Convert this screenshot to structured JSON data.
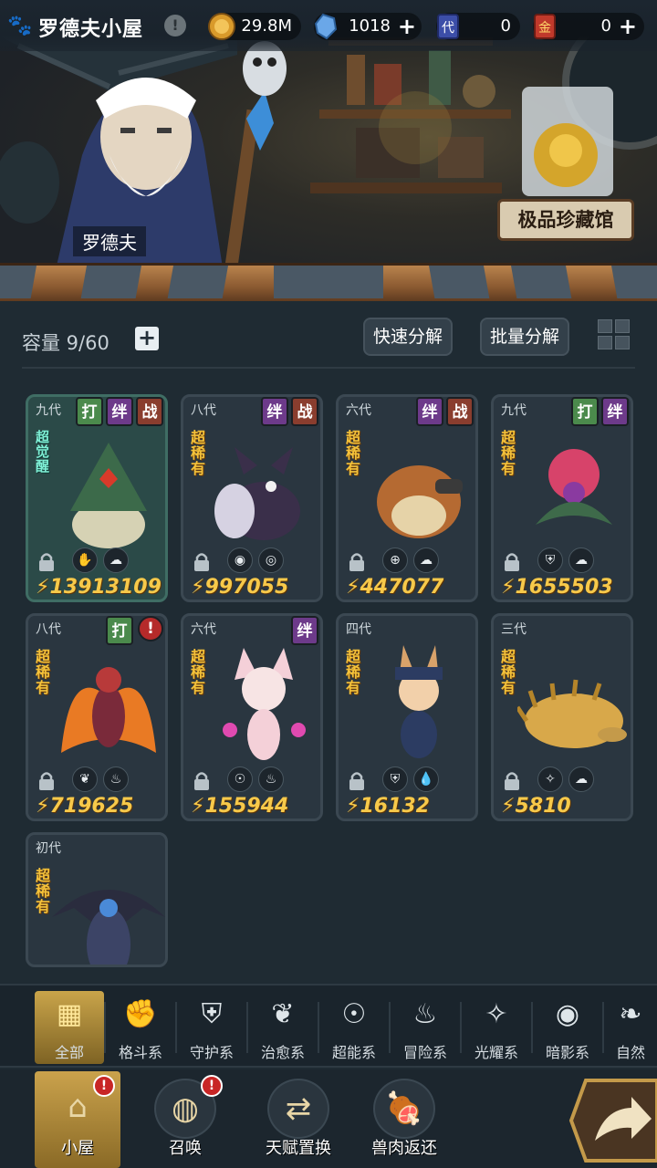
{
  "header": {
    "title": "罗德夫小屋",
    "info_glyph": "!",
    "gold": "29.8M",
    "crystal": "1018",
    "ticket_purple": "0",
    "ticket_gold": "0",
    "plus_glyph": "+",
    "ticket_purple_glyph": "代",
    "ticket_gold_glyph": "金"
  },
  "banner": {
    "npc_name": "罗德夫",
    "treasure_button": "极品珍藏馆"
  },
  "toolbar": {
    "capacity_label": "容量 9/60",
    "quick_decompose": "快速分解",
    "batch_decompose": "批量分解"
  },
  "tags": {
    "da": "打",
    "ban": "绊",
    "zhan": "战",
    "alert": "!"
  },
  "cards": [
    {
      "generation": "九代",
      "badge": "超觉醒",
      "power": "13913109",
      "tags": [
        "da",
        "ban",
        "zhan"
      ],
      "featured": true
    },
    {
      "generation": "八代",
      "badge": "超稀有",
      "power": "997055",
      "tags": [
        "ban",
        "zhan"
      ]
    },
    {
      "generation": "六代",
      "badge": "超稀有",
      "power": "447077",
      "tags": [
        "ban",
        "zhan"
      ]
    },
    {
      "generation": "九代",
      "badge": "超稀有",
      "power": "1655503",
      "tags": [
        "da",
        "ban"
      ]
    },
    {
      "generation": "八代",
      "badge": "超稀有",
      "power": "719625",
      "tags": [
        "da",
        "alert"
      ]
    },
    {
      "generation": "六代",
      "badge": "超稀有",
      "power": "155944",
      "tags": [
        "ban"
      ]
    },
    {
      "generation": "四代",
      "badge": "超稀有",
      "power": "16132",
      "tags": []
    },
    {
      "generation": "三代",
      "badge": "超稀有",
      "power": "5810",
      "tags": []
    },
    {
      "generation": "初代",
      "badge": "超稀有",
      "power": "",
      "tags": []
    }
  ],
  "filters": [
    {
      "label": "全部",
      "icon": "blocks-icon"
    },
    {
      "label": "格斗系",
      "icon": "fist-icon"
    },
    {
      "label": "守护系",
      "icon": "shield-icon"
    },
    {
      "label": "治愈系",
      "icon": "sprout-icon"
    },
    {
      "label": "超能系",
      "icon": "alien-icon"
    },
    {
      "label": "冒险系",
      "icon": "flame-emblem-icon"
    },
    {
      "label": "光耀系",
      "icon": "star-burst-icon"
    },
    {
      "label": "暗影系",
      "icon": "eye-icon"
    },
    {
      "label": "自然",
      "icon": "leaf-icon"
    }
  ],
  "nav": [
    {
      "label": "小屋",
      "icon": "house-icon",
      "alert": "!"
    },
    {
      "label": "召唤",
      "icon": "egg-icon",
      "alert": "!"
    },
    {
      "label": "天赋置换",
      "icon": "swap-icon"
    },
    {
      "label": "兽肉返还",
      "icon": "meat-icon"
    }
  ],
  "colors": {
    "accent_gold": "#c9a44a",
    "power_text": "#f7c94a",
    "rarity_text": "#f3c13a",
    "awaken_text": "#7ff0d6"
  }
}
